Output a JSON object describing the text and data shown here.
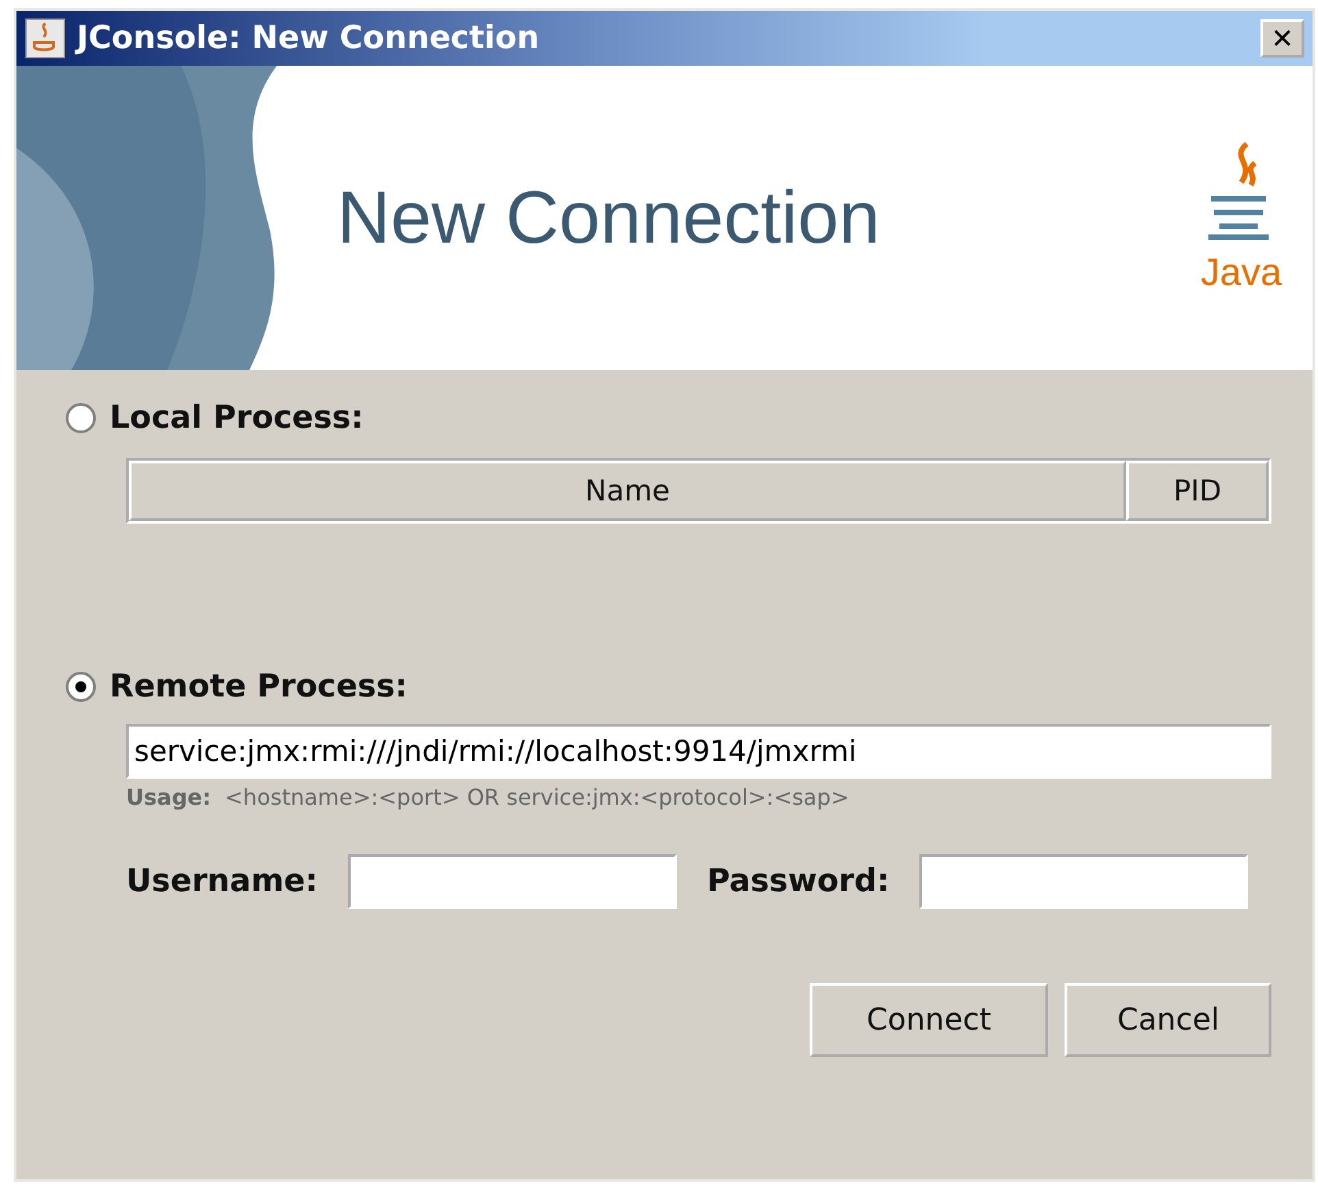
{
  "window": {
    "title": "JConsole: New Connection",
    "close": "✕"
  },
  "banner": {
    "heading": "New Connection",
    "logo_text": "Java"
  },
  "local_process": {
    "label": "Local Process:",
    "selected": false,
    "columns": [
      "Name",
      "PID"
    ]
  },
  "remote_process": {
    "label": "Remote Process:",
    "selected": true,
    "value": "service:jmx:rmi:///jndi/rmi://localhost:9914/jmxrmi",
    "usage_label": "Usage:",
    "usage": "<hostname>:<port> OR service:jmx:<protocol>:<sap>"
  },
  "credentials": [
    {
      "label": "Username:"
    },
    {
      "label": "Password:"
    }
  ],
  "buttons": [
    "Connect",
    "Cancel"
  ]
}
